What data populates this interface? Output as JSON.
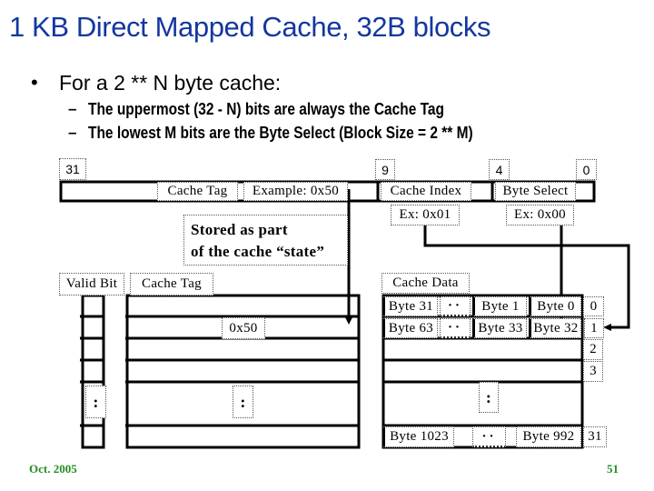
{
  "slide": {
    "title": "1 KB Direct Mapped Cache, 32B blocks",
    "bullet_glyph": "•",
    "bullet": "For a 2 ** N byte cache:",
    "sub_glyph": "–",
    "sub_bullets": [
      "The uppermost (32 - N) bits are always the Cache Tag",
      "The lowest M bits are the Byte Select (Block Size = 2 ** M)"
    ],
    "footer_date": "Oct. 2005",
    "page_number": "51"
  },
  "address": {
    "bit_labels": [
      "31",
      "9",
      "4",
      "0"
    ],
    "cache_tag": "Cache Tag",
    "tag_example": "Example: 0x50",
    "cache_index": "Cache Index",
    "byte_select": "Byte Select",
    "index_example": "Ex: 0x01",
    "byte_example": "Ex: 0x00",
    "state_note": [
      "Stored as part",
      "of the cache “state”"
    ]
  },
  "cache": {
    "valid_bit_label": "Valid Bit",
    "cache_tag_label": "Cache Tag",
    "cache_data_label": "Cache Data",
    "tag_value": "0x50",
    "vertical_ellipsis": ":",
    "horizontal_ellipsis": "··",
    "rows": [
      {
        "index": "0",
        "high_byte": "Byte 31",
        "second_byte": "Byte 1",
        "low_byte": "Byte 0"
      },
      {
        "index": "1",
        "high_byte": "Byte 63",
        "second_byte": "Byte 33",
        "low_byte": "Byte 32"
      },
      {
        "index": "2"
      },
      {
        "index": "3"
      },
      {
        "index": "31",
        "high_byte": "Byte 1023",
        "low_byte": "Byte 992"
      }
    ]
  },
  "colors": {
    "title": "#13379f",
    "footer": "#1f8f1f",
    "lines": "#000000"
  }
}
